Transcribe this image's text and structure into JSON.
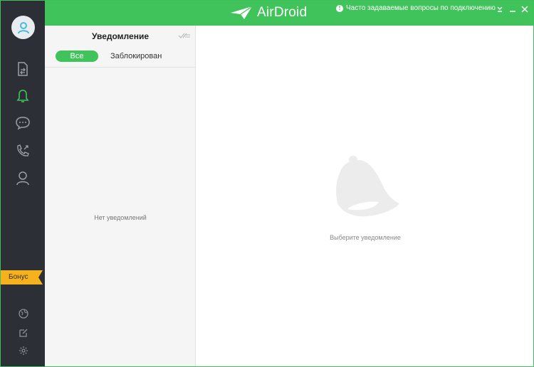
{
  "app": {
    "name": "AirDroid"
  },
  "topbar": {
    "faq_label": "Часто задаваемые вопросы по подключению",
    "accent_color": "#3fc35a"
  },
  "sidebar": {
    "items": [
      {
        "icon": "file-transfer-icon"
      },
      {
        "icon": "bell-icon",
        "active": true
      },
      {
        "icon": "message-icon"
      },
      {
        "icon": "call-icon"
      },
      {
        "icon": "contacts-icon"
      }
    ],
    "bonus_label": "Бонус",
    "bottom": [
      {
        "icon": "globe-icon"
      },
      {
        "icon": "edit-icon"
      },
      {
        "icon": "settings-icon"
      }
    ]
  },
  "notifications": {
    "title": "Уведомление",
    "tabs": [
      {
        "label": "Все",
        "selected": true
      },
      {
        "label": "Заблокирован",
        "selected": false
      }
    ],
    "empty_text": "Нет уведомлений"
  },
  "main": {
    "placeholder": "Выберите уведомление"
  }
}
